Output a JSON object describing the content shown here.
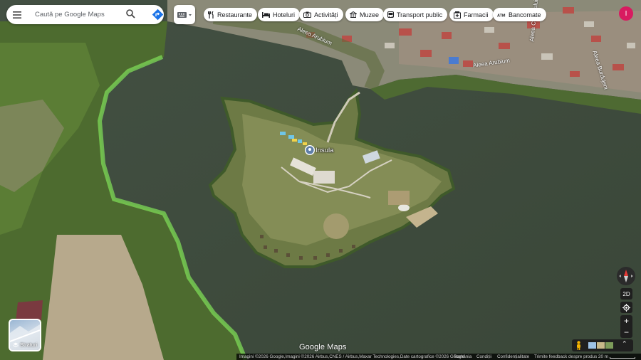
{
  "search": {
    "placeholder": "Caută pe Google Maps"
  },
  "chips": [
    {
      "label": "Restaurante",
      "icon": "fork-knife-icon"
    },
    {
      "label": "Hoteluri",
      "icon": "bed-icon"
    },
    {
      "label": "Activități",
      "icon": "camera-icon"
    },
    {
      "label": "Muzee",
      "icon": "museum-icon"
    },
    {
      "label": "Transport public",
      "icon": "bus-icon"
    },
    {
      "label": "Farmacii",
      "icon": "pharmacy-icon"
    },
    {
      "label": "Bancomate",
      "icon": "atm-icon"
    }
  ],
  "account": {
    "initial": "I",
    "color": "#d81b60"
  },
  "map": {
    "place_label": "Insula",
    "street_labels": [
      "Aleea Arubium",
      "Aleea Arubium",
      "Aleea Cățărăului",
      "Aleea Burdujeni"
    ]
  },
  "controls": {
    "mode_toggle": "2D",
    "zoom_in": "+",
    "zoom_out": "−",
    "expand": "⌃"
  },
  "layers": {
    "label": "Straturi"
  },
  "logo": "Google Maps",
  "footer": {
    "attribution": "Imagini ©2026 Google,Imagini ©2026 Airbus,CNES / Airbus,Maxar Technologies,Date cartografice ©2026 Google",
    "country": "România",
    "terms": "Condiții",
    "privacy": "Confidențialitate",
    "feedback": "Trimite feedback despre produs",
    "scale": "20 m"
  },
  "colors": {
    "water": "#3d4a3b",
    "algae": "#7ed957",
    "accent": "#1a73e8"
  }
}
